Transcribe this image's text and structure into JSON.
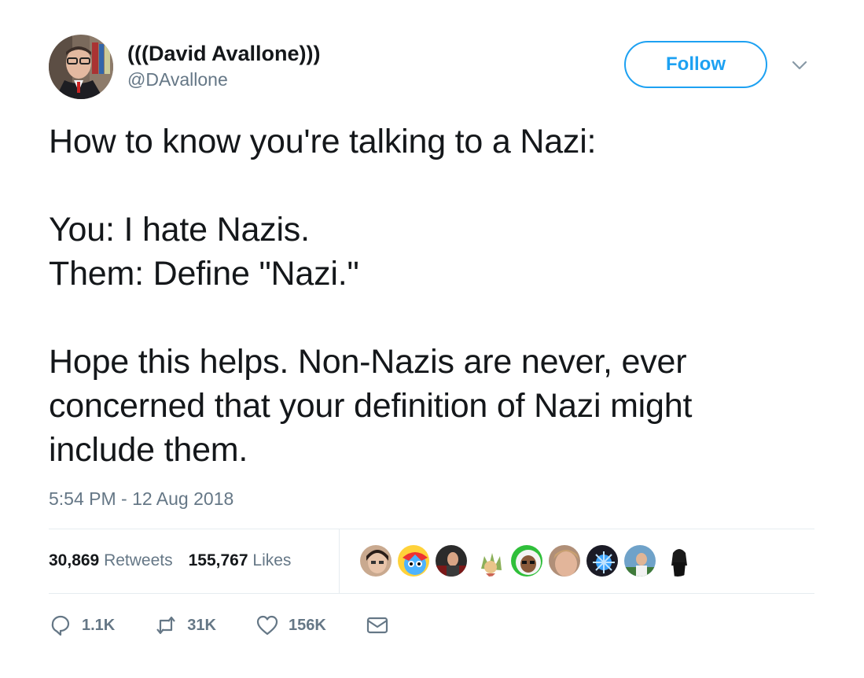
{
  "author": {
    "display_name": "(((David Avallone)))",
    "handle": "@DAvallone"
  },
  "follow_label": "Follow",
  "tweet": {
    "text": "How to know you're talking to a Nazi:\n\nYou: I hate Nazis.\nThem: Define \"Nazi.\"\n\nHope this helps. Non-Nazis are never, ever\nconcerned that your definition of Nazi might\ninclude them.",
    "timestamp": "5:54 PM - 12 Aug 2018"
  },
  "stats": {
    "retweets_count": "30,869",
    "retweets_label": "Retweets",
    "likes_count": "155,767",
    "likes_label": "Likes"
  },
  "actions": {
    "reply_count": "1.1K",
    "retweet_count": "31K",
    "like_count": "156K"
  },
  "colors": {
    "accent": "#1da1f2",
    "secondary_text": "#657786",
    "divider": "#e6ecf0"
  }
}
